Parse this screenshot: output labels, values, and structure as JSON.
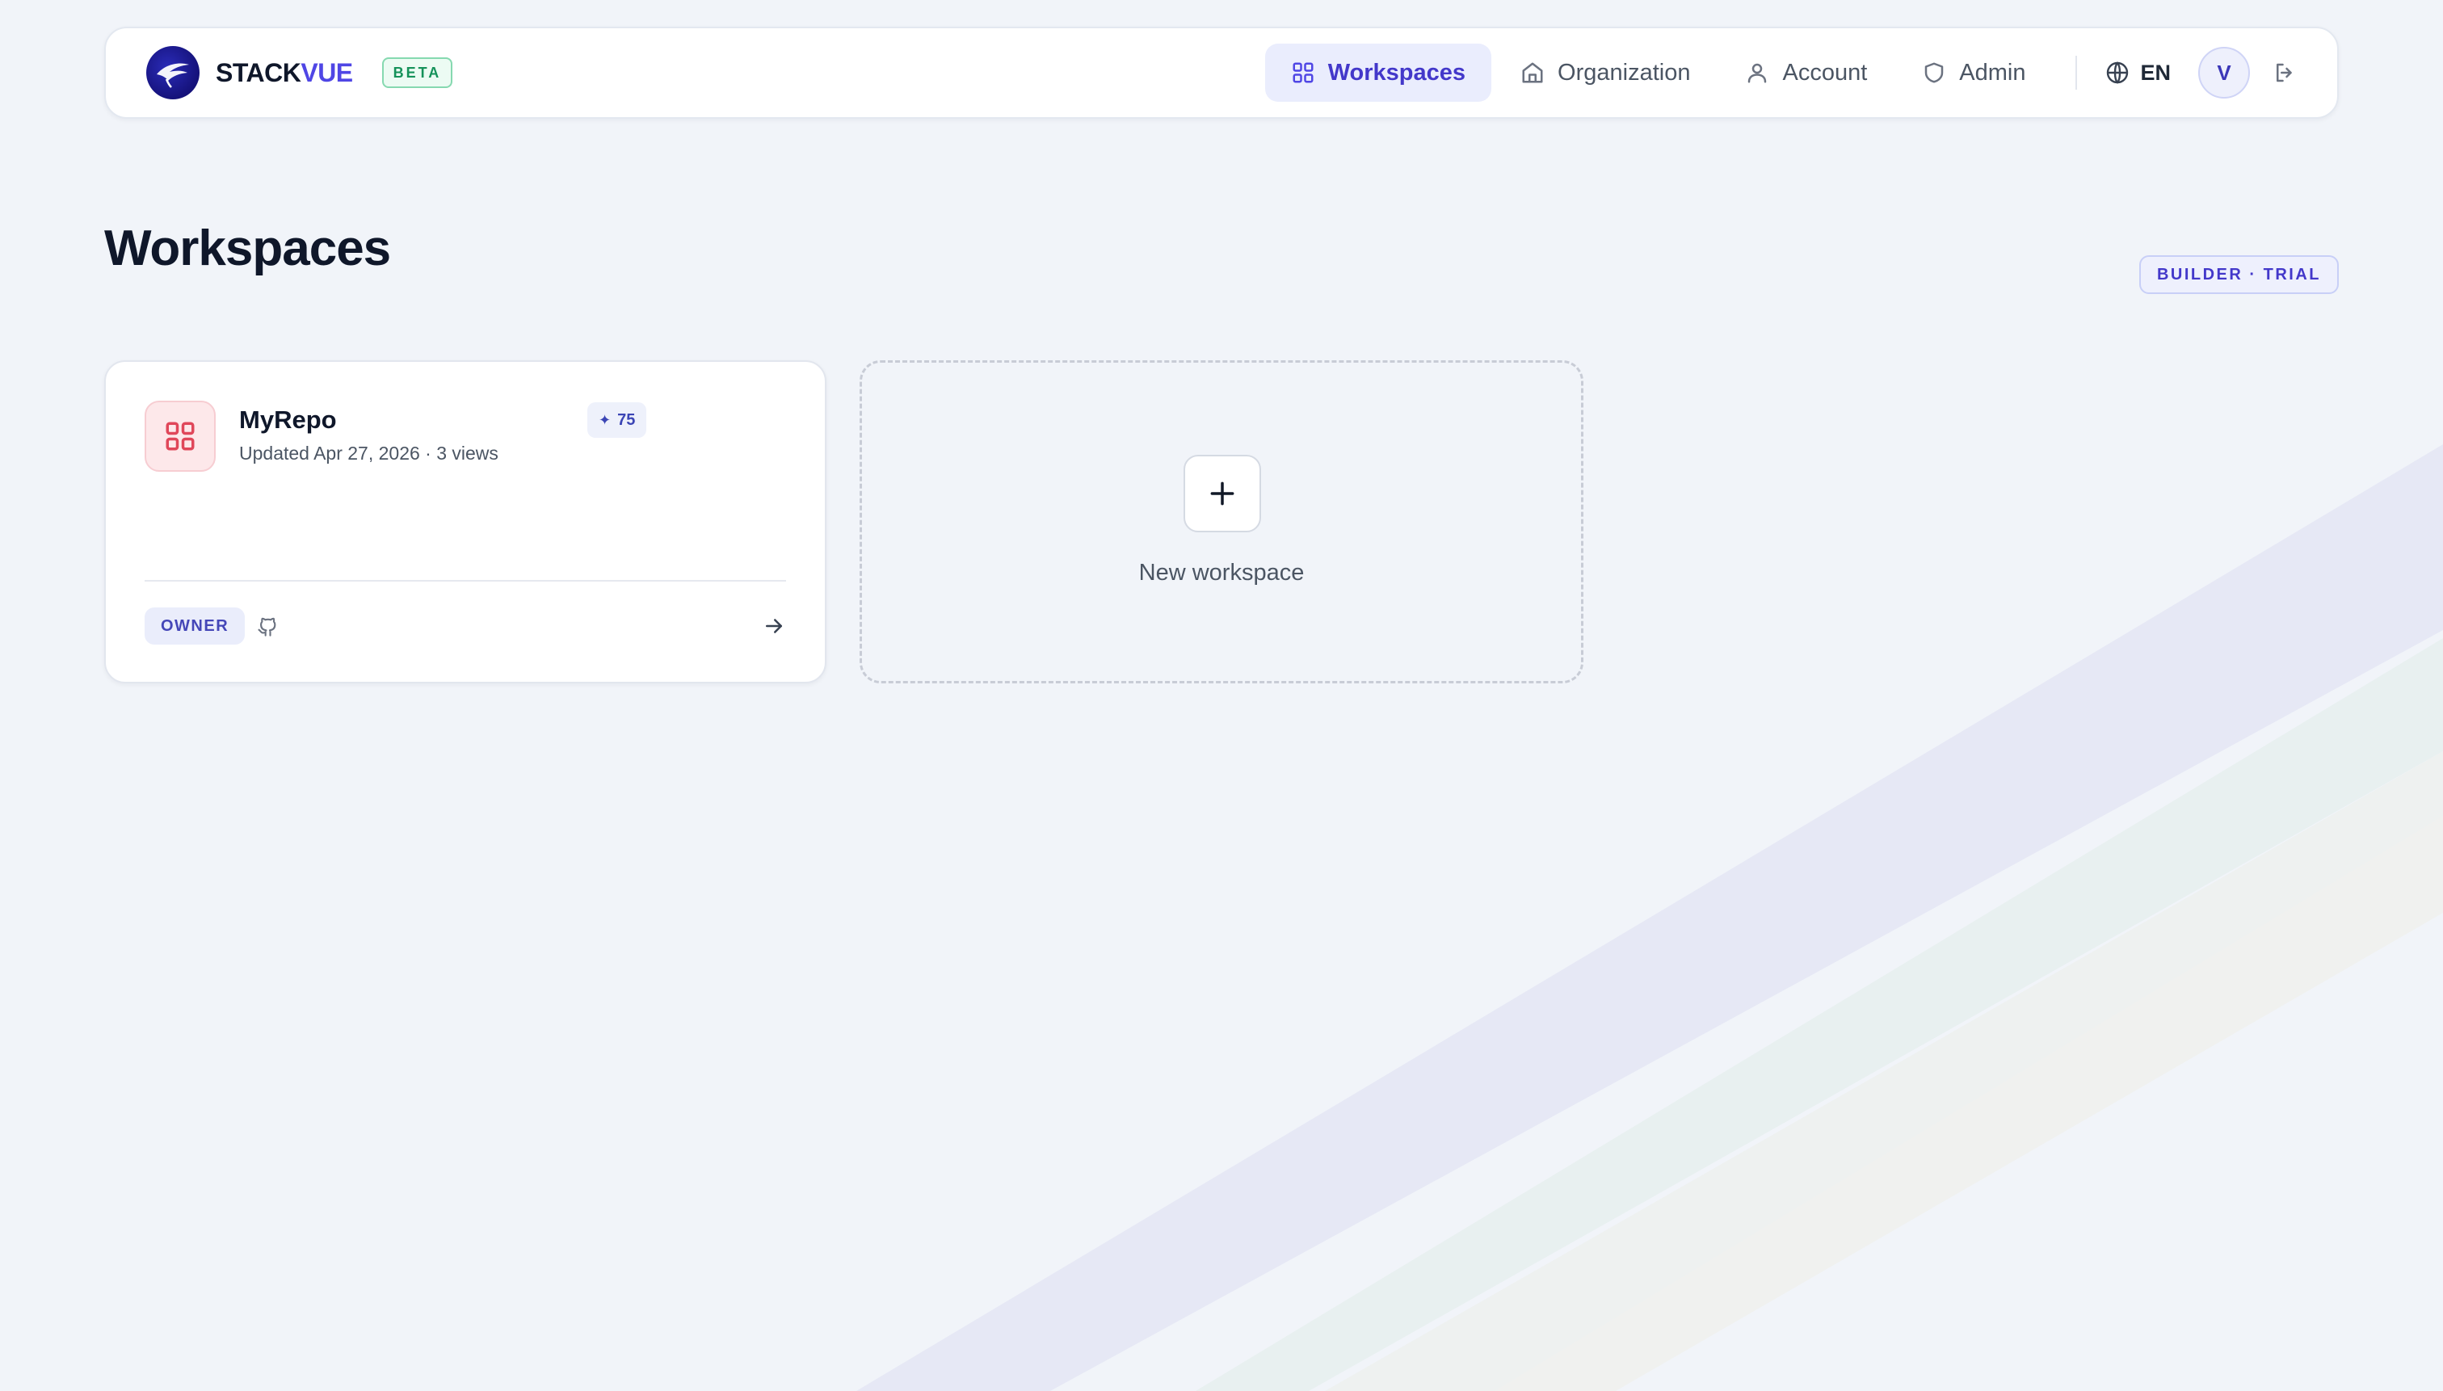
{
  "brand": {
    "name_part1": "STACK",
    "name_part2": "VUE",
    "badge": "BETA"
  },
  "nav": {
    "items": [
      {
        "label": "Workspaces",
        "icon": "grid-icon",
        "active": true
      },
      {
        "label": "Organization",
        "icon": "home-icon",
        "active": false
      },
      {
        "label": "Account",
        "icon": "user-icon",
        "active": false
      },
      {
        "label": "Admin",
        "icon": "shield-icon",
        "active": false
      }
    ],
    "language": "EN",
    "avatar_initial": "V",
    "logout_icon": "logout-icon"
  },
  "page": {
    "title": "Workspaces",
    "plan_badge": "BUILDER · TRIAL"
  },
  "workspaces": [
    {
      "name": "MyRepo",
      "meta": "Updated Apr 27, 2026 · 3 views",
      "score": "75",
      "role": "OWNER",
      "icon": "grid-icon",
      "source_icon": "github-icon"
    }
  ],
  "new_workspace": {
    "label": "New workspace"
  },
  "colors": {
    "accent": "#4f46e5",
    "background": "#f1f4f9",
    "beta_green": "#15925a",
    "workspace_icon_red": "#e0475a"
  }
}
